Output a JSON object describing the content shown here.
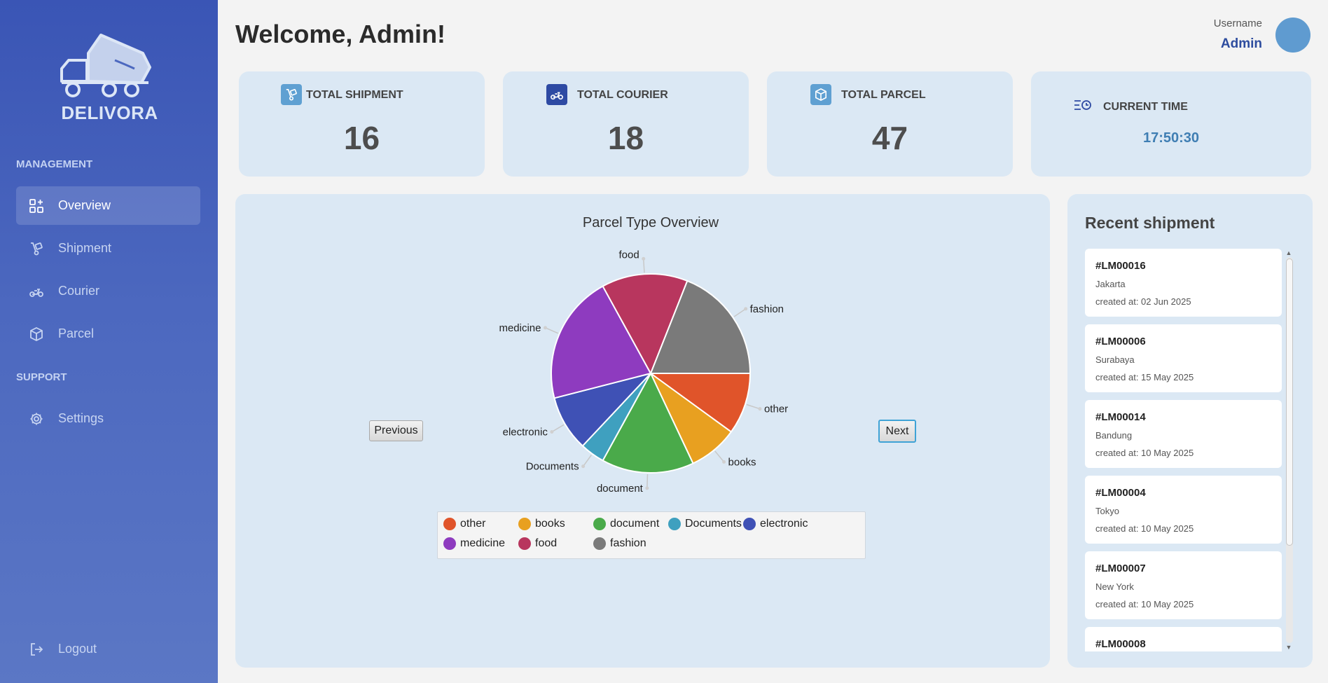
{
  "brand": {
    "name": "DELIVORA"
  },
  "sidebar": {
    "sections": [
      {
        "label": "MANAGEMENT"
      },
      {
        "label": "SUPPORT"
      }
    ],
    "items": [
      {
        "label": "Overview",
        "icon": "dashboard-icon",
        "active": true
      },
      {
        "label": "Shipment",
        "icon": "hand-truck-icon"
      },
      {
        "label": "Courier",
        "icon": "scooter-icon"
      },
      {
        "label": "Parcel",
        "icon": "box-icon"
      },
      {
        "label": "Settings",
        "icon": "gear-icon"
      }
    ],
    "logout": "Logout"
  },
  "header": {
    "welcome": "Welcome, Admin!",
    "username_label": "Username",
    "username": "Admin"
  },
  "stats": [
    {
      "title": "TOTAL SHIPMENT",
      "value": "16",
      "icon": "hand-truck-icon"
    },
    {
      "title": "TOTAL COURIER",
      "value": "18",
      "icon": "scooter-icon"
    },
    {
      "title": "TOTAL PARCEL",
      "value": "47",
      "icon": "box-icon"
    },
    {
      "title": "CURRENT TIME",
      "value": "17:50:30",
      "icon": "clock-list-icon"
    }
  ],
  "chart_controls": {
    "previous": "Previous",
    "next": "Next"
  },
  "chart_data": {
    "type": "pie",
    "title": "Parcel Type Overview",
    "slices": [
      {
        "label": "other",
        "value": 10,
        "color": "#e0542a"
      },
      {
        "label": "books",
        "value": 8,
        "color": "#e8a020"
      },
      {
        "label": "document",
        "value": 15,
        "color": "#4aaa4a"
      },
      {
        "label": "Documents",
        "value": 4,
        "color": "#3fa0bf"
      },
      {
        "label": "electronic",
        "value": 9,
        "color": "#3f51b5"
      },
      {
        "label": "medicine",
        "value": 21,
        "color": "#8e3bbf"
      },
      {
        "label": "food",
        "value": 14,
        "color": "#b8365e"
      },
      {
        "label": "fashion",
        "value": 19,
        "color": "#7a7a7a"
      }
    ],
    "legend_position": "bottom"
  },
  "recent": {
    "title": "Recent shipment",
    "items": [
      {
        "id": "#LM00016",
        "city": "Jakarta",
        "created": "created at: 02 Jun 2025"
      },
      {
        "id": "#LM00006",
        "city": "Surabaya",
        "created": "created at: 15 May 2025"
      },
      {
        "id": "#LM00014",
        "city": "Bandung",
        "created": "created at: 10 May 2025"
      },
      {
        "id": "#LM00004",
        "city": "Tokyo",
        "created": "created at: 10 May 2025"
      },
      {
        "id": "#LM00007",
        "city": "New York",
        "created": "created at: 10 May 2025"
      },
      {
        "id": "#LM00008",
        "city": "",
        "created": ""
      }
    ]
  }
}
